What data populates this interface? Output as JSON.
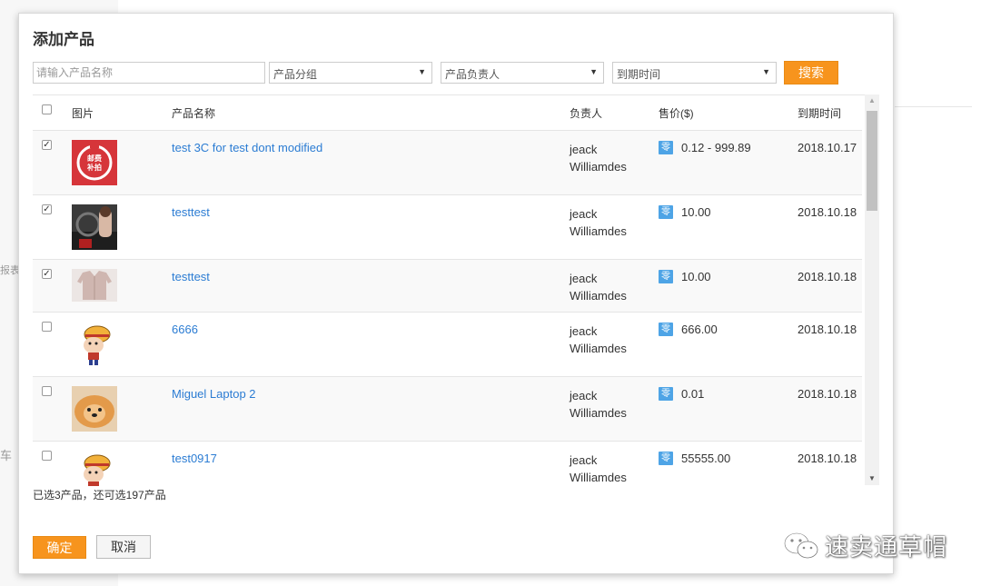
{
  "background": {
    "fragment_report": "报表",
    "fragment_car": "车"
  },
  "dialog": {
    "title": "添加产品",
    "search": {
      "placeholder": "请输入产品名称",
      "value": ""
    },
    "filters": [
      {
        "label": "产品分组"
      },
      {
        "label": "产品负责人"
      },
      {
        "label": "到期时间"
      }
    ],
    "search_button": "搜索",
    "columns": {
      "image": "图片",
      "name": "产品名称",
      "owner": "负责人",
      "price": "售价($)",
      "expire": "到期时间"
    },
    "price_badge": "零",
    "products": [
      {
        "checked": true,
        "image": "red-badge-icon",
        "badge_text": "邮费补拍",
        "name": "test 3C for test dont modified",
        "owner_line1": "jeack",
        "owner_line2": "Williamdes",
        "price": "0.12 - 999.89",
        "expire": "2018.10.17"
      },
      {
        "checked": true,
        "image": "car-photo",
        "name": "testtest",
        "owner_line1": "jeack",
        "owner_line2": "Williamdes",
        "price": "10.00",
        "expire": "2018.10.18"
      },
      {
        "checked": true,
        "image": "sweater-photo",
        "name": "testtest",
        "owner_line1": "jeack",
        "owner_line2": "Williamdes",
        "price": "10.00",
        "expire": "2018.10.18"
      },
      {
        "checked": false,
        "image": "cartoon-pirate-icon",
        "name": "6666",
        "owner_line1": "jeack",
        "owner_line2": "Williamdes",
        "price": "666.00",
        "expire": "2018.10.18"
      },
      {
        "checked": false,
        "image": "dog-photo",
        "name": "Miguel Laptop 2",
        "owner_line1": "jeack",
        "owner_line2": "Williamdes",
        "price": "0.01",
        "expire": "2018.10.18"
      },
      {
        "checked": false,
        "image": "cartoon-pirate-icon",
        "name": "test0917",
        "owner_line1": "jeack",
        "owner_line2": "Williamdes",
        "price": "55555.00",
        "expire": "2018.10.18"
      }
    ],
    "selected_info": "已选3产品，还可选197产品",
    "confirm_button": "确定",
    "cancel_button": "取消"
  },
  "watermark": {
    "text": "速卖通草帽"
  },
  "colors": {
    "accent": "#f7941d",
    "link": "#2b7cd3",
    "badge": "#4ea4e6"
  }
}
